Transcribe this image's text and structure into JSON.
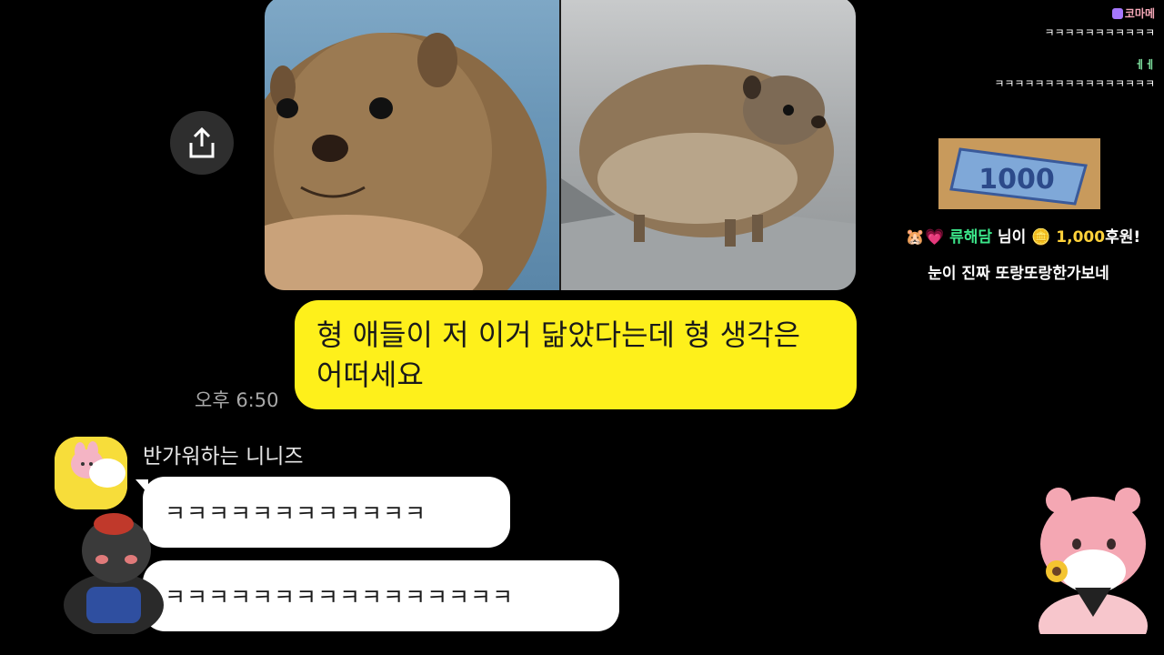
{
  "chat": {
    "share_label": "",
    "outgoing_message": "형 애들이 저 이거 닮았다는데 형 생각은 어떠세요",
    "timestamp": "오후 6:50",
    "sender_name": "반가워하는 니니즈",
    "incoming": [
      {
        "text": "ㅋㅋㅋㅋㅋㅋㅋㅋㅋㅋㅋㅋ"
      },
      {
        "text": "ㅋㅋㅋㅋㅋㅋㅋㅋㅋㅋㅋㅋㅋㅋㅋㅋ"
      }
    ]
  },
  "stream_chat": {
    "messages": [
      {
        "name": "코마메",
        "text": "ㅋㅋㅋㅋㅋㅋㅋㅋㅋㅋㅋ"
      },
      {
        "name": "ㅔㅔ",
        "text": "ㅋㅋㅋㅋㅋㅋㅋㅋㅋㅋㅋㅋㅋㅋㅋㅋ"
      }
    ]
  },
  "donation": {
    "banner_value": "1000",
    "donor": "류해담",
    "suffix_1": "님이",
    "amount": "1,000",
    "suffix_2": "후원!",
    "message": "눈이 진짜 또랑또랑한가보네"
  },
  "colors": {
    "kakao_yellow": "#fef01b",
    "background": "#000000",
    "donor_green": "#3ce68a",
    "amount_yellow": "#ffd23a"
  }
}
